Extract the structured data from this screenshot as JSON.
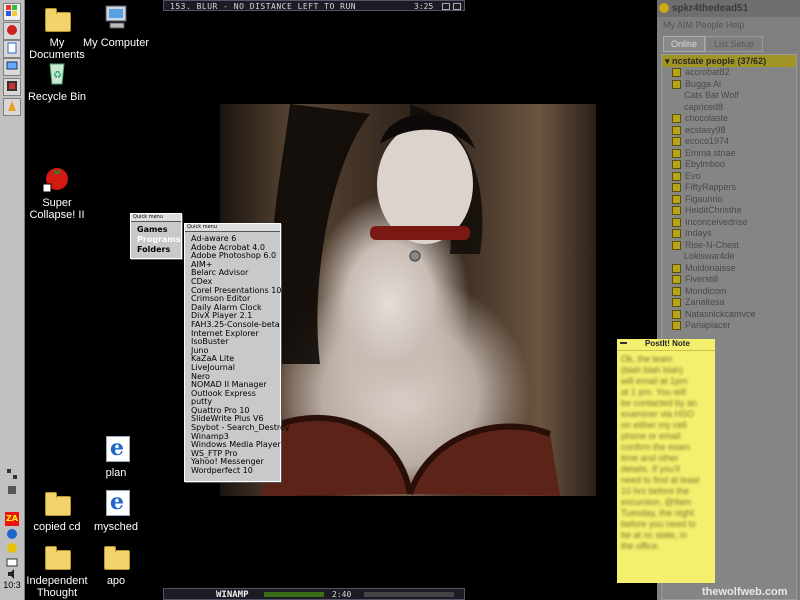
{
  "taskbar": {
    "icons": [
      "windows-logo-icon",
      "app-icon-red",
      "app-icon-doc",
      "app-icon-net",
      "app-icon-media",
      "app-icon-run"
    ],
    "tray_icons": [
      "tray-icon-network",
      "tray-icon-zonealarm",
      "tray-icon-ie",
      "tray-icon-aim",
      "tray-icon-mail",
      "tray-icon-speaker"
    ],
    "clock": "10:3"
  },
  "desktop_icons": [
    {
      "label": "My Documents",
      "icon": "folder-icon"
    },
    {
      "label": "My Computer",
      "icon": "computer-icon"
    },
    {
      "label": "Recycle Bin",
      "icon": "recycle-bin-icon"
    },
    {
      "label": "Super Collapse! II",
      "icon": "tomato-game-icon"
    },
    {
      "label": "plan",
      "icon": "ie-icon"
    },
    {
      "label": "copied cd",
      "icon": "folder-icon"
    },
    {
      "label": "mysched",
      "icon": "ie-icon"
    },
    {
      "label": "Independent Thought",
      "icon": "folder-icon"
    },
    {
      "label": "apo",
      "icon": "folder-icon"
    }
  ],
  "winamp_top": {
    "track": "153. BLUR - NO DISTANCE LEFT TO RUN",
    "time": "3:25"
  },
  "winamp_bottom": {
    "logo": "WINAMP",
    "time": "2:40"
  },
  "quick_menu_1": {
    "title": "Quick menu",
    "items": [
      "Games",
      "Programs",
      "Folders"
    ]
  },
  "quick_menu_2": {
    "title": "Quick menu",
    "items": [
      "Ad-aware 6",
      "Adobe Acrobat 4.0",
      "Adobe Photoshop 6.0",
      "AIM+",
      "Belarc Advisor",
      "CDex",
      "Corel Presentations 10",
      "Crimson Editor",
      "Daily Alarm Clock",
      "DivX Player 2.1",
      "FAH3.25-Console-beta",
      "Internet Explorer",
      "IsoBuster",
      "Juno",
      "KaZaA Lite",
      "LiveJournal",
      "Nero",
      "NOMAD II Manager",
      "Outlook Express",
      "putty",
      "Quattro Pro 10",
      "SlideWrite Plus V6",
      "Spybot - Search_Destroy",
      "Winamp3",
      "Windows Media Player",
      "WS_FTP Pro",
      "Yahoo! Messenger",
      "Wordperfect 10"
    ]
  },
  "aim": {
    "title": "spkr4thedead51",
    "menu": "My AIM  People  Help",
    "tabs": [
      "Online",
      "List Setup"
    ],
    "group": "ncstate people (37/62)",
    "buddies": [
      "accrobat82",
      "Bugga Al",
      "Cats Bat Wolf",
      "capriced8",
      "chocolaste",
      "ecstasy98",
      "ecoco1974",
      "Emma stnae",
      "Ebylmboo",
      "Evo",
      "FiftyRappers",
      "Figaunrio",
      "HeiditChristhe",
      "Inconceivedrise",
      "Indays",
      "Rise-N-Chest",
      "Lokiswar4de",
      "Muldonaisse",
      "Fiverstill",
      "Mondicom",
      "Zanaltesa",
      "Natasnickcamvce",
      "Pariaplacer"
    ]
  },
  "postit": {
    "title": "PostIt! Note",
    "lines": [
      "Ok, the team",
      "(blah blah blah)",
      "will email at 1pm",
      "at 1 pm. You will",
      "be contacted by an",
      "examiner via HSO",
      "on either my cell",
      "phone or email",
      "confirm the exam",
      "time and other",
      "details. If you'll",
      "need to find at least",
      "10 hrs before the",
      "excursion, @9am",
      "Tuesday, the night",
      "before you need to",
      "be at nc state, in",
      "the office."
    ]
  },
  "watermark": "thewolfweb.com",
  "colors": {
    "aim_bg": "#7f7f7f",
    "postit": "#f5ef6e",
    "menu_bg": "#c9c9c9"
  }
}
